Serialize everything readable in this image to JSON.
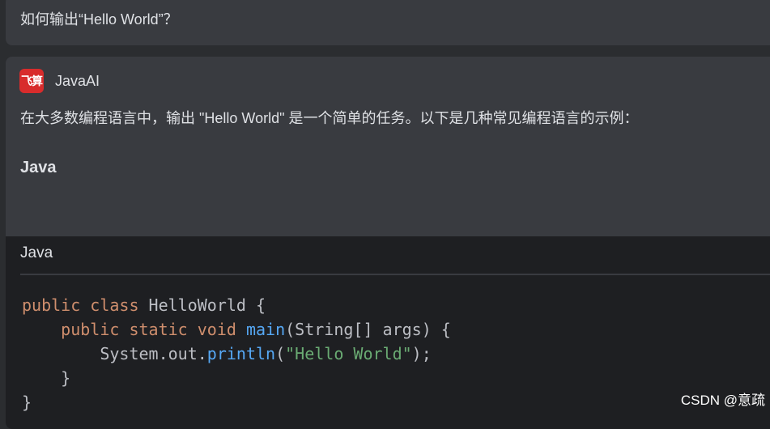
{
  "question": {
    "text": "如何输出“Hello World”？"
  },
  "answer": {
    "assistant_logo": "飞算",
    "assistant_name": "JavaAI",
    "intro": "在大多数编程语言中，输出 \"Hello World\" 是一个简单的任务。以下是几种常见编程语言的示例：",
    "section_heading": "Java",
    "code_block": {
      "language": "Java",
      "lines": [
        {
          "indent": "",
          "keyword": "public class",
          "rest": " HelloWorld {"
        },
        {
          "indent": "    ",
          "keyword": "public static void",
          "fn": "main",
          "rest": "(String[] args) {"
        },
        {
          "indent": "        ",
          "prefix": "System.out.",
          "fn": "println",
          "open": "(",
          "str": "\"Hello World\"",
          "close": ");"
        },
        {
          "indent": "    ",
          "rest": "}"
        },
        {
          "indent": "",
          "rest": "}"
        }
      ]
    }
  },
  "watermark": "CSDN @意疏",
  "colors": {
    "background": "#2b2d30",
    "card": "#393b40",
    "code_background": "#1e1f22",
    "keyword": "#cf8e6d",
    "function": "#56a8f5",
    "string": "#6aab73",
    "logo": "#d82c2c"
  }
}
